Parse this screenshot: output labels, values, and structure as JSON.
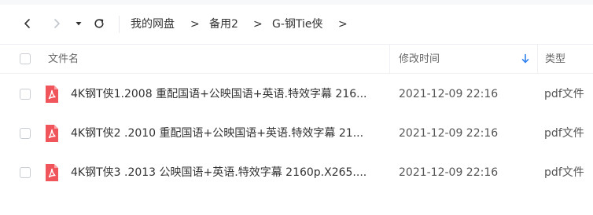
{
  "breadcrumb": {
    "root": "我的网盘",
    "level1": "备用2",
    "level2": "G-钢Tie侠",
    "separator": ">"
  },
  "table": {
    "columns": {
      "name": "文件名",
      "modified": "修改时间",
      "type": "类型"
    },
    "rows": [
      {
        "name": "4K钢T侠1.2008 重配国语+公映国语+英语.特效字幕 216...",
        "modified": "2021-12-09 22:16",
        "type": "pdf文件"
      },
      {
        "name": "4K钢T侠2 .2010 重配国语+公映国语+英语.特效字幕 21...",
        "modified": "2021-12-09 22:16",
        "type": "pdf文件"
      },
      {
        "name": "4K钢T侠3 .2013 公映国语+英语.特效字幕 2160p.X265....",
        "modified": "2021-12-09 22:16",
        "type": "pdf文件"
      }
    ]
  },
  "icons": {
    "back": "chevron-left-icon",
    "forward": "chevron-right-icon",
    "history": "caret-down-icon",
    "refresh": "refresh-icon",
    "sort": "arrow-down-icon",
    "file": "pdf-file-icon"
  },
  "colors": {
    "accent": "#2f80ed",
    "pdf": "#f0555b",
    "disabled": "#c0c4cc"
  }
}
